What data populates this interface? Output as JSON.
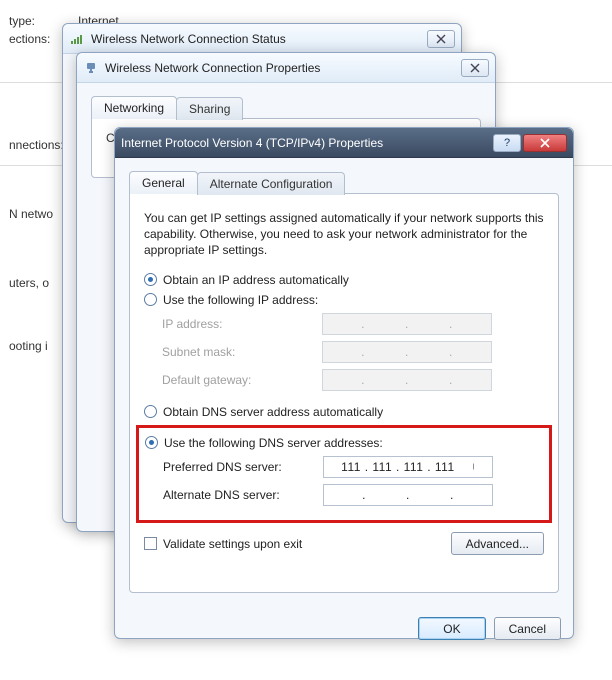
{
  "bg": {
    "typeLabel": "type:",
    "typeValue": "Internet",
    "connectionsLabel": "ections:",
    "connections": "nnections:",
    "networkLabel": "N netwo",
    "routersLabel": "uters, o",
    "ootingLabel": "ooting i"
  },
  "win1": {
    "title": "Wireless Network Connection Status"
  },
  "win2": {
    "title": "Wireless Network Connection Properties",
    "tabs": {
      "networking": "Networking",
      "sharing": "Sharing"
    },
    "connectText": "Co"
  },
  "win3": {
    "title": "Internet Protocol Version 4 (TCP/IPv4) Properties",
    "tabs": {
      "general": "General",
      "alt": "Alternate Configuration"
    },
    "intro": "You can get IP settings assigned automatically if your network supports this capability. Otherwise, you need to ask your network administrator for the appropriate IP settings.",
    "ip": {
      "auto": "Obtain an IP address automatically",
      "manual": "Use the following IP address:",
      "ipaddr": "IP address:",
      "subnet": "Subnet mask:",
      "gateway": "Default gateway:"
    },
    "dns": {
      "auto": "Obtain DNS server address automatically",
      "manual": "Use the following DNS server addresses:",
      "pref": "Preferred DNS server:",
      "alt": "Alternate DNS server:",
      "prefValue": "111 . 111 . 111 . 111"
    },
    "validate": "Validate settings upon exit",
    "advanced": "Advanced...",
    "ok": "OK",
    "cancel": "Cancel"
  }
}
